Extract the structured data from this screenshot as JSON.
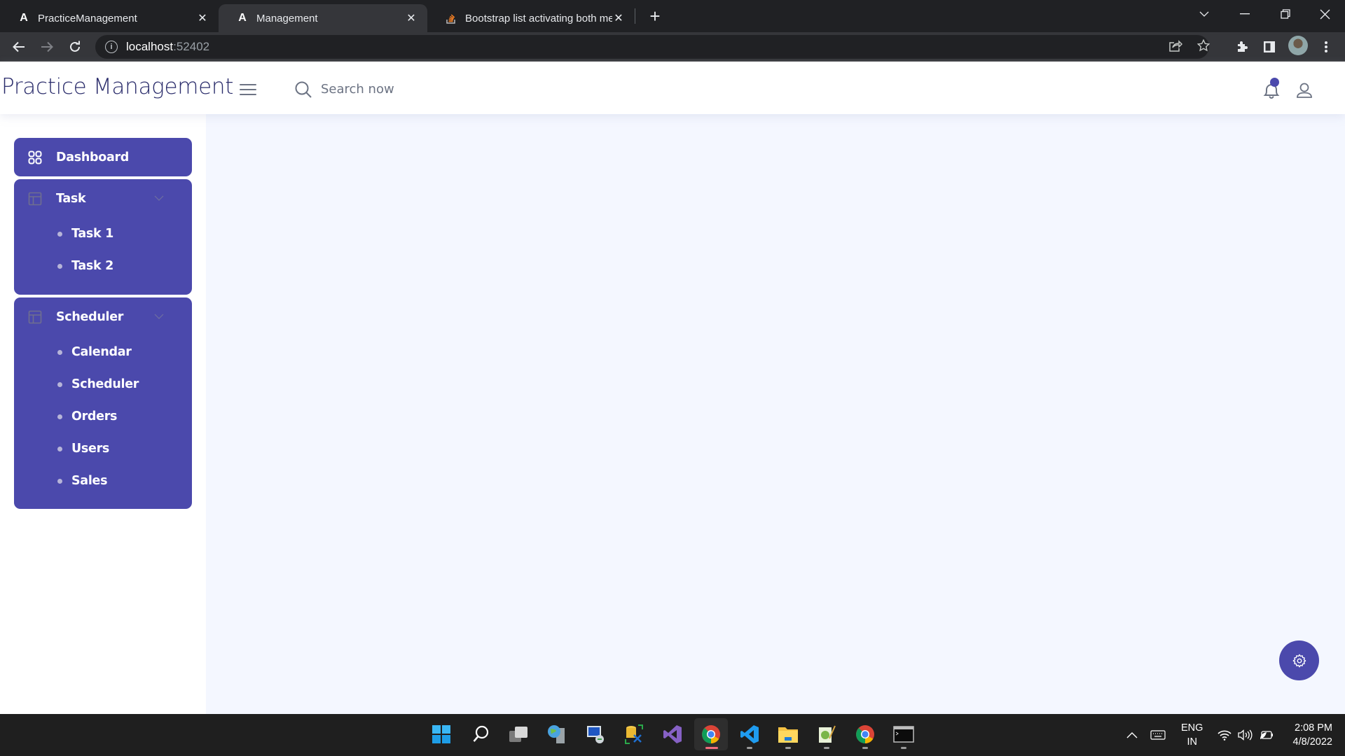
{
  "browser": {
    "tabs": [
      {
        "title": "PracticeManagement",
        "favicon": "angular-icon",
        "active": false
      },
      {
        "title": "Management",
        "favicon": "angular-icon",
        "active": true
      },
      {
        "title": "Bootstrap list activating both me",
        "favicon": "stackoverflow-icon",
        "active": false
      }
    ],
    "new_tab_label": "+",
    "url_host": "localhost",
    "url_port": ":52402"
  },
  "header": {
    "brand": "Practice Management",
    "search_placeholder": "Search now",
    "notification_indicator": true
  },
  "sidebar": {
    "dashboard": {
      "label": "Dashboard",
      "icon": "grid-icon"
    },
    "groups": [
      {
        "label": "Task",
        "icon": "layout-icon",
        "expanded": true,
        "items": [
          "Task 1",
          "Task 2"
        ]
      },
      {
        "label": "Scheduler",
        "icon": "layout-icon",
        "expanded": true,
        "items": [
          "Calendar",
          "Scheduler",
          "Orders",
          "Users",
          "Sales"
        ]
      }
    ]
  },
  "colors": {
    "primary": "#4b49ac",
    "content_bg": "#f4f7ff",
    "brand_text": "#2a2c6b"
  },
  "settings_fab": {
    "icon": "gear-icon"
  },
  "taskbar": {
    "apps": [
      "windows-start",
      "search",
      "task-view",
      "network-app",
      "remote-desktop",
      "database-tool",
      "visual-studio",
      "chrome",
      "vs-code",
      "file-explorer",
      "notepad-plus-plus",
      "chrome",
      "terminal"
    ],
    "language_line1": "ENG",
    "language_line2": "IN",
    "time": "2:08 PM",
    "date": "4/8/2022"
  }
}
